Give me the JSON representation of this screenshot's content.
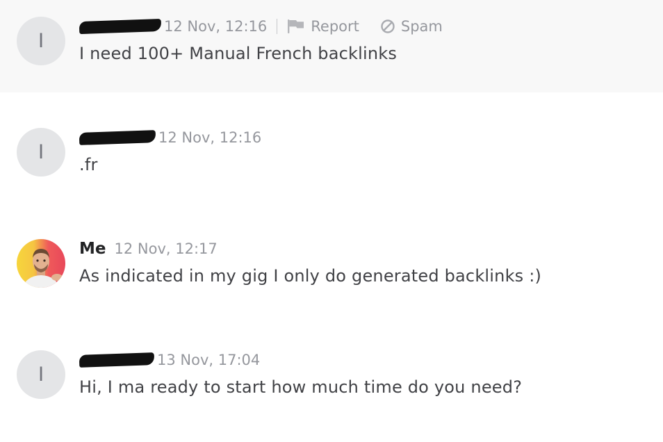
{
  "messages": [
    {
      "avatar_initial": "I",
      "sender": "",
      "sender_redacted": true,
      "timestamp": "12 Nov, 12:16",
      "actions": {
        "report_label": "Report",
        "spam_label": "Spam"
      },
      "text": "I need 100+ Manual French backlinks"
    },
    {
      "avatar_initial": "I",
      "sender": "",
      "sender_redacted": true,
      "timestamp": "12 Nov, 12:16",
      "text": ".fr"
    },
    {
      "avatar_initial": "",
      "sender": "Me",
      "timestamp": "12 Nov, 12:17",
      "text": "As indicated in my gig I only do generated backlinks :)"
    },
    {
      "avatar_initial": "I",
      "sender": "",
      "sender_redacted": true,
      "timestamp": "13 Nov, 17:04",
      "text": "Hi, I ma ready to start how much time do you need?"
    }
  ],
  "icons": {
    "report": "flag-icon",
    "spam": "block-icon"
  },
  "colors": {
    "highlight_background": "#f8f8f8",
    "avatar_background": "#e4e5e7",
    "muted_text": "#95979d",
    "body_text": "#404145"
  }
}
